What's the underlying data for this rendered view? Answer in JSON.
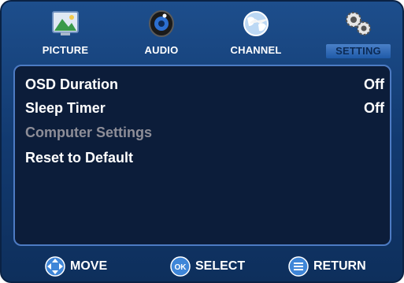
{
  "tabs": [
    {
      "id": "picture",
      "label": "PICTURE",
      "icon": "picture-icon",
      "active": false
    },
    {
      "id": "audio",
      "label": "AUDIO",
      "icon": "speaker-icon",
      "active": false
    },
    {
      "id": "channel",
      "label": "CHANNEL",
      "icon": "globe-icon",
      "active": false
    },
    {
      "id": "setting",
      "label": "SETTING",
      "icon": "gears-icon",
      "active": true
    }
  ],
  "menu": {
    "items": [
      {
        "label": "OSD Duration",
        "value": "Off",
        "enabled": true
      },
      {
        "label": "Sleep Timer",
        "value": "Off",
        "enabled": true
      },
      {
        "label": "Computer Settings",
        "value": "",
        "enabled": false
      },
      {
        "label": "Reset to Default",
        "value": "",
        "enabled": true
      }
    ]
  },
  "footer": {
    "move_label": "MOVE",
    "move_icon": "dpad-icon",
    "select_label": "SELECT",
    "select_icon": "ok-button-icon",
    "select_icon_text": "OK",
    "return_label": "RETURN",
    "return_icon": "menu-list-icon"
  },
  "colors": {
    "background": "#1d4e8c",
    "panel": "#0c1d3a",
    "panel_border": "#4d7bc3",
    "text": "#ffffff",
    "disabled_text": "#8e8e98",
    "active_tab": "#2f69b8"
  }
}
